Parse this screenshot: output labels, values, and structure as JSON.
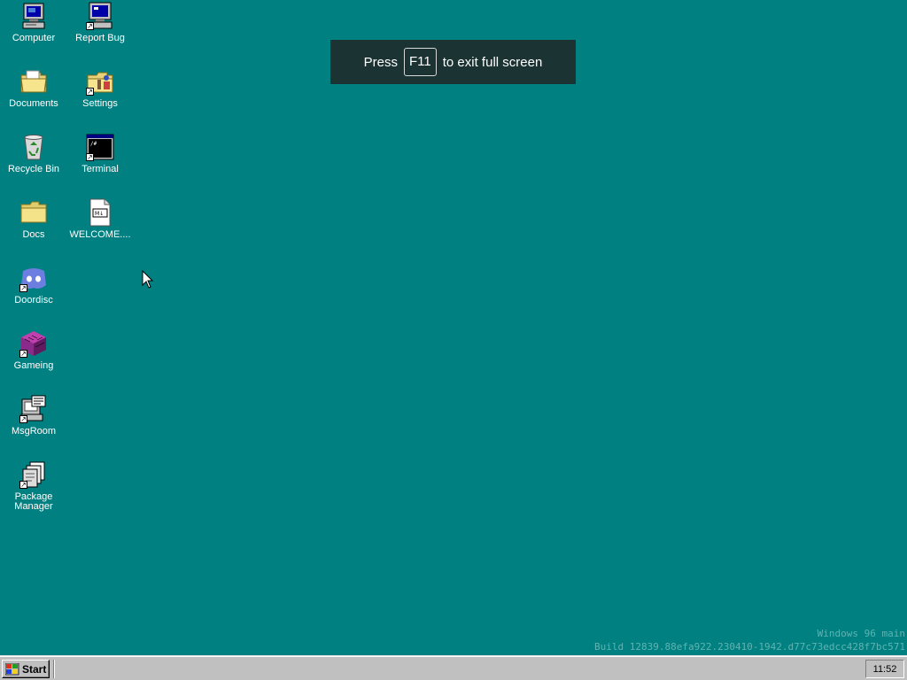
{
  "desktop": {
    "icons": [
      {
        "label": "Computer",
        "icon": "computer-icon"
      },
      {
        "label": "Report Bug",
        "icon": "report-bug-icon"
      },
      {
        "label": "Documents",
        "icon": "documents-folder-icon"
      },
      {
        "label": "Settings",
        "icon": "settings-icon"
      },
      {
        "label": "Recycle Bin",
        "icon": "recycle-bin-icon"
      },
      {
        "label": "Terminal",
        "icon": "terminal-icon"
      },
      {
        "label": "Docs",
        "icon": "folder-icon"
      },
      {
        "label": "WELCOME....",
        "icon": "markdown-file-icon"
      },
      {
        "label": "Doordisc",
        "icon": "doordisc-icon"
      },
      {
        "label": "Gameing",
        "icon": "gameing-icon"
      },
      {
        "label": "MsgRoom",
        "icon": "msgroom-icon"
      },
      {
        "label": "Package Manager",
        "icon": "package-manager-icon"
      }
    ]
  },
  "fullscreen_toast": {
    "prefix": "Press",
    "key": "F11",
    "suffix": "to exit full screen"
  },
  "watermark": {
    "line1": "Windows 96 main",
    "line2": "Build 12839.88efa922.230410-1942.d77c73edcc428f7bc571"
  },
  "taskbar": {
    "start_label": "Start",
    "clock": "11:52"
  },
  "colors": {
    "desktop": "#008080",
    "taskbar": "#c0c0c0"
  }
}
